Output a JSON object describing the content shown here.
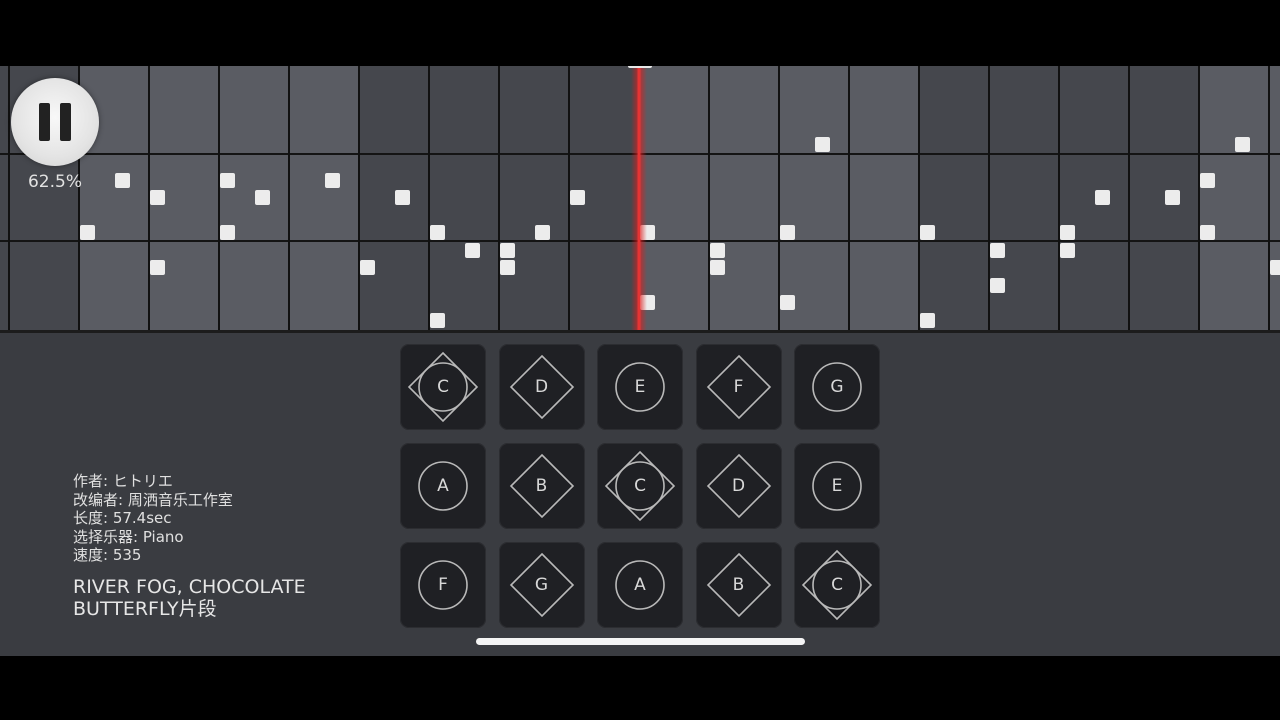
{
  "player": {
    "pause_button": "pause",
    "zoom": "62.5%"
  },
  "song_info": {
    "author": "作者: ヒトリエ",
    "arranger": "改编者: 周洒音乐工作室",
    "length": "长度: 57.4sec",
    "instrument": "选择乐器: Piano",
    "speed": "速度: 535",
    "title_line1": "RIVER FOG, CHOCOLATE",
    "title_line2": "BUTTERFLY片段"
  },
  "keys": [
    [
      {
        "label": "C",
        "icon": "circle-diamond-icon"
      },
      {
        "label": "D",
        "icon": "diamond-icon"
      },
      {
        "label": "E",
        "icon": "circle-icon"
      },
      {
        "label": "F",
        "icon": "diamond-icon"
      },
      {
        "label": "G",
        "icon": "circle-icon"
      }
    ],
    [
      {
        "label": "A",
        "icon": "circle-icon"
      },
      {
        "label": "B",
        "icon": "diamond-icon"
      },
      {
        "label": "C",
        "icon": "circle-diamond-icon"
      },
      {
        "label": "D",
        "icon": "diamond-icon"
      },
      {
        "label": "E",
        "icon": "circle-icon"
      }
    ],
    [
      {
        "label": "F",
        "icon": "circle-icon"
      },
      {
        "label": "G",
        "icon": "diamond-icon"
      },
      {
        "label": "A",
        "icon": "circle-icon"
      },
      {
        "label": "B",
        "icon": "diamond-icon"
      },
      {
        "label": "C",
        "icon": "circle-diamond-icon"
      }
    ]
  ],
  "colors": {
    "playhead": "#ff3b3b",
    "note": "#ececec",
    "panel": "#3a3c41",
    "key": "#1f2024"
  }
}
